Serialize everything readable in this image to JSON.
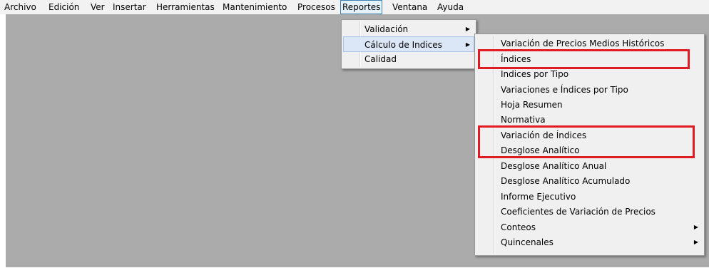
{
  "menubar": {
    "items": [
      "Archivo",
      "Edición",
      "Ver",
      "Insertar",
      "Herramientas",
      "Mantenimiento",
      "Procesos",
      "Reportes",
      "Ventana",
      "Ayuda"
    ]
  },
  "reportes_menu": {
    "items": [
      {
        "label": "Validación",
        "submenu": true
      },
      {
        "label": "Cálculo de Indices",
        "submenu": true
      },
      {
        "label": "Calidad",
        "submenu": false
      }
    ]
  },
  "indices_submenu": {
    "items": [
      {
        "label": "Variación de Precios Medios Históricos",
        "submenu": false
      },
      {
        "label": "Índices",
        "submenu": false
      },
      {
        "label": "Indices por Tipo",
        "submenu": false
      },
      {
        "label": "Variaciones e Índices por Tipo",
        "submenu": false
      },
      {
        "label": "Hoja Resumen",
        "submenu": false
      },
      {
        "label": "Normativa",
        "submenu": false
      },
      {
        "label": "Variación de Índices",
        "submenu": false
      },
      {
        "label": "Desglose Analítico",
        "submenu": false
      },
      {
        "label": "Desglose Analítico Anual",
        "submenu": false
      },
      {
        "label": "Desglose Analítico Acumulado",
        "submenu": false
      },
      {
        "label": "Informe Ejecutivo",
        "submenu": false
      },
      {
        "label": "Coeficientes de Variación de Precios",
        "submenu": false
      },
      {
        "label": "Conteos",
        "submenu": true
      },
      {
        "label": "Quincenales",
        "submenu": true
      }
    ]
  },
  "icons": {
    "submenu_arrow": "triangle-right-icon"
  },
  "colors": {
    "highlight_box": "#e01b24",
    "workspace": "#ababab",
    "menu_bg": "#f0f0f0"
  }
}
